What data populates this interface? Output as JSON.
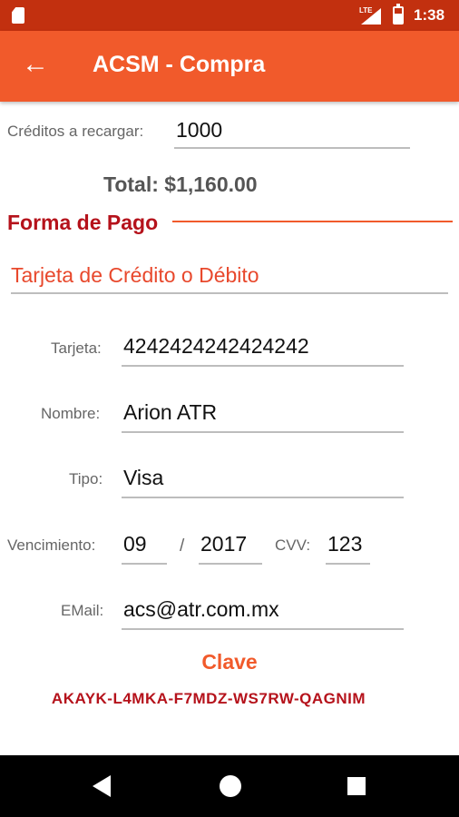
{
  "status_bar": {
    "time": "1:38",
    "network": "LTE"
  },
  "app_bar": {
    "title": "ACSM - Compra",
    "back_icon": "arrow-left-icon"
  },
  "credits": {
    "label": "Créditos a recargar:",
    "value": "1000"
  },
  "total": {
    "text": "Total: $1,160.00"
  },
  "payment": {
    "section_title": "Forma de Pago",
    "method": "Tarjeta de Crédito o Débito"
  },
  "card": {
    "number_label": "Tarjeta:",
    "number": "4242424242424242",
    "name_label": "Nombre:",
    "name": "Arion ATR",
    "type_label": "Tipo:",
    "type": "Visa",
    "expiry_label": "Vencimiento:",
    "month": "09",
    "separator": "/",
    "year": "2017",
    "cvv_label": "CVV:",
    "cvv": "123",
    "email_label": "EMail:",
    "email": "acs@atr.com.mx"
  },
  "clave": {
    "title": "Clave",
    "key": "AKAYK-L4MKA-F7MDZ-WS7RW-QAGNIM"
  },
  "colors": {
    "primary": "#f15a2b",
    "primary_dark": "#c2300f",
    "accent_red": "#b5121b"
  }
}
